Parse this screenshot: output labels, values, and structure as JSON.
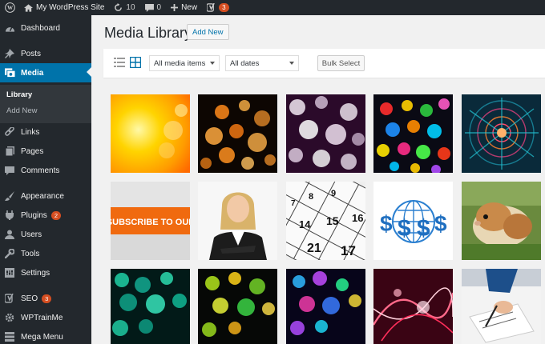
{
  "adminbar": {
    "site_name": "My WordPress Site",
    "updates_count": "10",
    "comments_count": "0",
    "new_label": "New",
    "yoast_count": "3"
  },
  "sidebar": {
    "items": [
      {
        "label": "Dashboard",
        "icon": "dashboard-icon"
      },
      {
        "label": "Posts",
        "icon": "pin-icon"
      },
      {
        "label": "Media",
        "icon": "media-icon"
      },
      {
        "label": "Links",
        "icon": "link-icon"
      },
      {
        "label": "Pages",
        "icon": "pages-icon"
      },
      {
        "label": "Comments",
        "icon": "comment-icon"
      },
      {
        "label": "Appearance",
        "icon": "brush-icon"
      },
      {
        "label": "Plugins",
        "icon": "plug-icon",
        "badge": "2"
      },
      {
        "label": "Users",
        "icon": "user-icon"
      },
      {
        "label": "Tools",
        "icon": "wrench-icon"
      },
      {
        "label": "Settings",
        "icon": "settings-icon"
      },
      {
        "label": "SEO",
        "icon": "yoast-icon",
        "badge": "3"
      },
      {
        "label": "WPTrainMe",
        "icon": "gear-icon"
      },
      {
        "label": "Mega Menu",
        "icon": "megamenu-icon"
      }
    ],
    "submenu": [
      "Library",
      "Add New"
    ]
  },
  "main": {
    "title": "Media Library",
    "add_new": "Add New",
    "filter_type": "All media items",
    "filter_date": "All dates",
    "bulk_select": "Bulk Select"
  },
  "media": [
    {
      "name": "yellow-sun-bokeh"
    },
    {
      "name": "orange-bokeh"
    },
    {
      "name": "white-bokeh"
    },
    {
      "name": "colorful-bokeh"
    },
    {
      "name": "fractal-flower"
    },
    {
      "name": "subscribe-banner",
      "text": "SUBSCRIBE TO OUR"
    },
    {
      "name": "business-woman"
    },
    {
      "name": "calendar-numbers"
    },
    {
      "name": "dollar-globe"
    },
    {
      "name": "guinea-pig"
    },
    {
      "name": "teal-bokeh"
    },
    {
      "name": "green-yellow-bokeh"
    },
    {
      "name": "purple-blue-bokeh"
    },
    {
      "name": "red-light-swirls"
    },
    {
      "name": "hand-writing"
    }
  ],
  "colors": {
    "admin_bg": "#23282d",
    "accent": "#0073aa",
    "badge": "#d54e21",
    "page_bg": "#f1f1f1"
  }
}
